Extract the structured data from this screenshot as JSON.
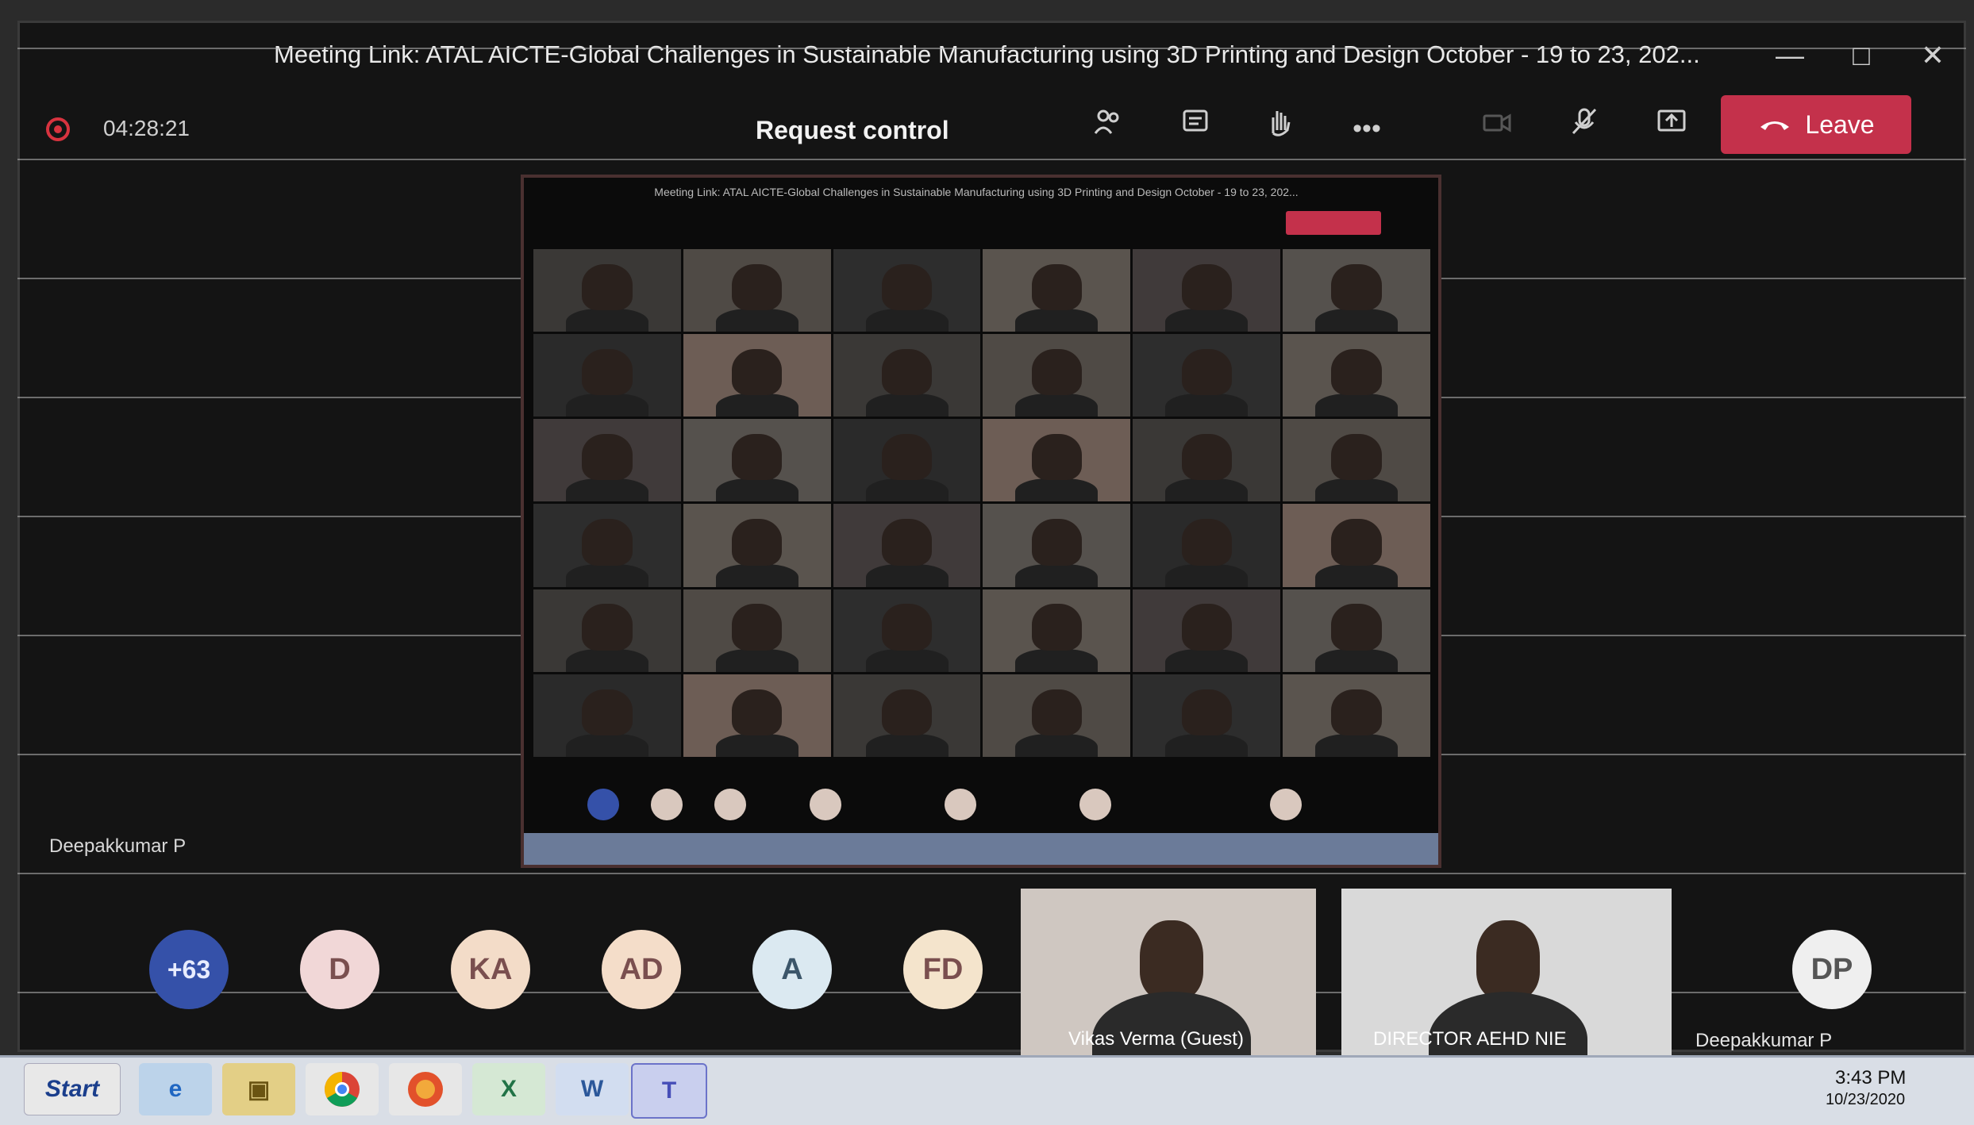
{
  "window": {
    "title": "Meeting Link: ATAL AICTE-Global Challenges in Sustainable Manufacturing using 3D Printing and Design October - 19 to 23, 202..."
  },
  "meeting_bar": {
    "timer": "04:28:21",
    "request_control": "Request control",
    "leave_label": "Leave",
    "icons": [
      "participants-icon",
      "chat-icon",
      "raise-hand-icon",
      "more-options-icon",
      "camera-off-icon",
      "mic-off-icon",
      "share-tray-icon"
    ]
  },
  "speaker_label": "Deepakkumar P",
  "participant_bar": {
    "overflow_count": "+63",
    "avatars": [
      {
        "initials": "D"
      },
      {
        "initials": "KA"
      },
      {
        "initials": "AD"
      },
      {
        "initials": "A"
      },
      {
        "initials": "FD"
      },
      {
        "initials": "DP"
      }
    ],
    "videos": [
      {
        "name": "Vikas Verma (Guest)"
      },
      {
        "name": "DIRECTOR AEHD NIE"
      }
    ],
    "dp_name": "Deepakkumar P"
  },
  "taskbar": {
    "start_label": "Start",
    "apps": [
      "ie-icon",
      "explorer-icon",
      "chrome-icon",
      "firefox-icon",
      "excel-icon",
      "word-icon",
      "teams-icon"
    ],
    "clock_time": "3:43 PM",
    "clock_date": "10/23/2020"
  },
  "colors": {
    "leave": "#c4314b",
    "recording": "#d8333f",
    "overflow_badge": "#3551a9"
  }
}
